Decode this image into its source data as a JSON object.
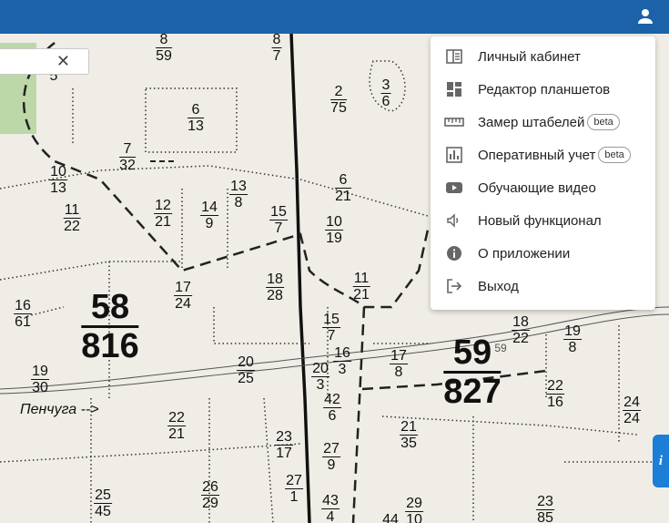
{
  "header": {
    "account_icon": "account-icon",
    "color": "#1c62a8"
  },
  "search": {
    "value": "",
    "clear_icon": "close-icon",
    "clear_glyph": "✕"
  },
  "menu": {
    "items": [
      {
        "label": "Личный кабинет",
        "icon": "cabinet-icon",
        "badge": ""
      },
      {
        "label": "Редактор планшетов",
        "icon": "dashboard-icon",
        "badge": ""
      },
      {
        "label": "Замер штабелей",
        "icon": "ruler-icon",
        "badge": "beta"
      },
      {
        "label": "Оперативный учет",
        "icon": "bar-chart-icon",
        "badge": "beta"
      },
      {
        "label": "Обучающие видео",
        "icon": "video-icon",
        "badge": ""
      },
      {
        "label": "Новый функционал",
        "icon": "speaker-icon",
        "badge": ""
      },
      {
        "label": "О приложении",
        "icon": "info-icon",
        "badge": ""
      },
      {
        "label": "Выход",
        "icon": "logout-icon",
        "badge": ""
      }
    ]
  },
  "info_tab": {
    "label": "i"
  },
  "map": {
    "place_label": "Пенчуга -->",
    "quarters": [
      {
        "n": "8",
        "a": "59"
      },
      {
        "n": "8",
        "a": "7"
      },
      {
        "n": "2",
        "a": "75"
      },
      {
        "n": "3",
        "a": "6"
      },
      {
        "n": "6",
        "a": "13"
      },
      {
        "n": "7",
        "a": "32"
      },
      {
        "n": "10",
        "a": "13"
      },
      {
        "n": "11",
        "a": "22"
      },
      {
        "n": "12",
        "a": "21"
      },
      {
        "n": "14",
        "a": "9"
      },
      {
        "n": "13",
        "a": "8"
      },
      {
        "n": "6",
        "a": "21"
      },
      {
        "n": "15",
        "a": "7"
      },
      {
        "n": "10",
        "a": "19"
      },
      {
        "n": "18",
        "a": "28"
      },
      {
        "n": "17",
        "a": "24"
      },
      {
        "n": "11",
        "a": "21"
      },
      {
        "n": "16",
        "a": "61"
      },
      {
        "n": "15",
        "a": "7"
      },
      {
        "n": "16",
        "a": "3"
      },
      {
        "n": "17",
        "a": "8"
      },
      {
        "n": "19",
        "a": "30"
      },
      {
        "n": "20",
        "a": "25"
      },
      {
        "n": "20",
        "a": "3"
      },
      {
        "n": "42",
        "a": "6"
      },
      {
        "n": "22",
        "a": "21"
      },
      {
        "n": "23",
        "a": "17"
      },
      {
        "n": "27",
        "a": "9"
      },
      {
        "n": "21",
        "a": "35"
      },
      {
        "n": "27",
        "a": "1"
      },
      {
        "n": "26",
        "a": "29"
      },
      {
        "n": "25",
        "a": "45"
      },
      {
        "n": "43",
        "a": "4"
      },
      {
        "n": "29",
        "a": "10"
      },
      {
        "n": "23",
        "a": "85"
      },
      {
        "n": "18",
        "a": "22"
      },
      {
        "n": "19",
        "a": "8"
      },
      {
        "n": "22",
        "a": "16"
      },
      {
        "n": "24",
        "a": "24"
      }
    ],
    "big_quarters": [
      {
        "n": "58",
        "a": "816"
      },
      {
        "n": "59",
        "a": "827"
      }
    ],
    "extra_labels": [
      "44",
      "59",
      "5"
    ]
  }
}
